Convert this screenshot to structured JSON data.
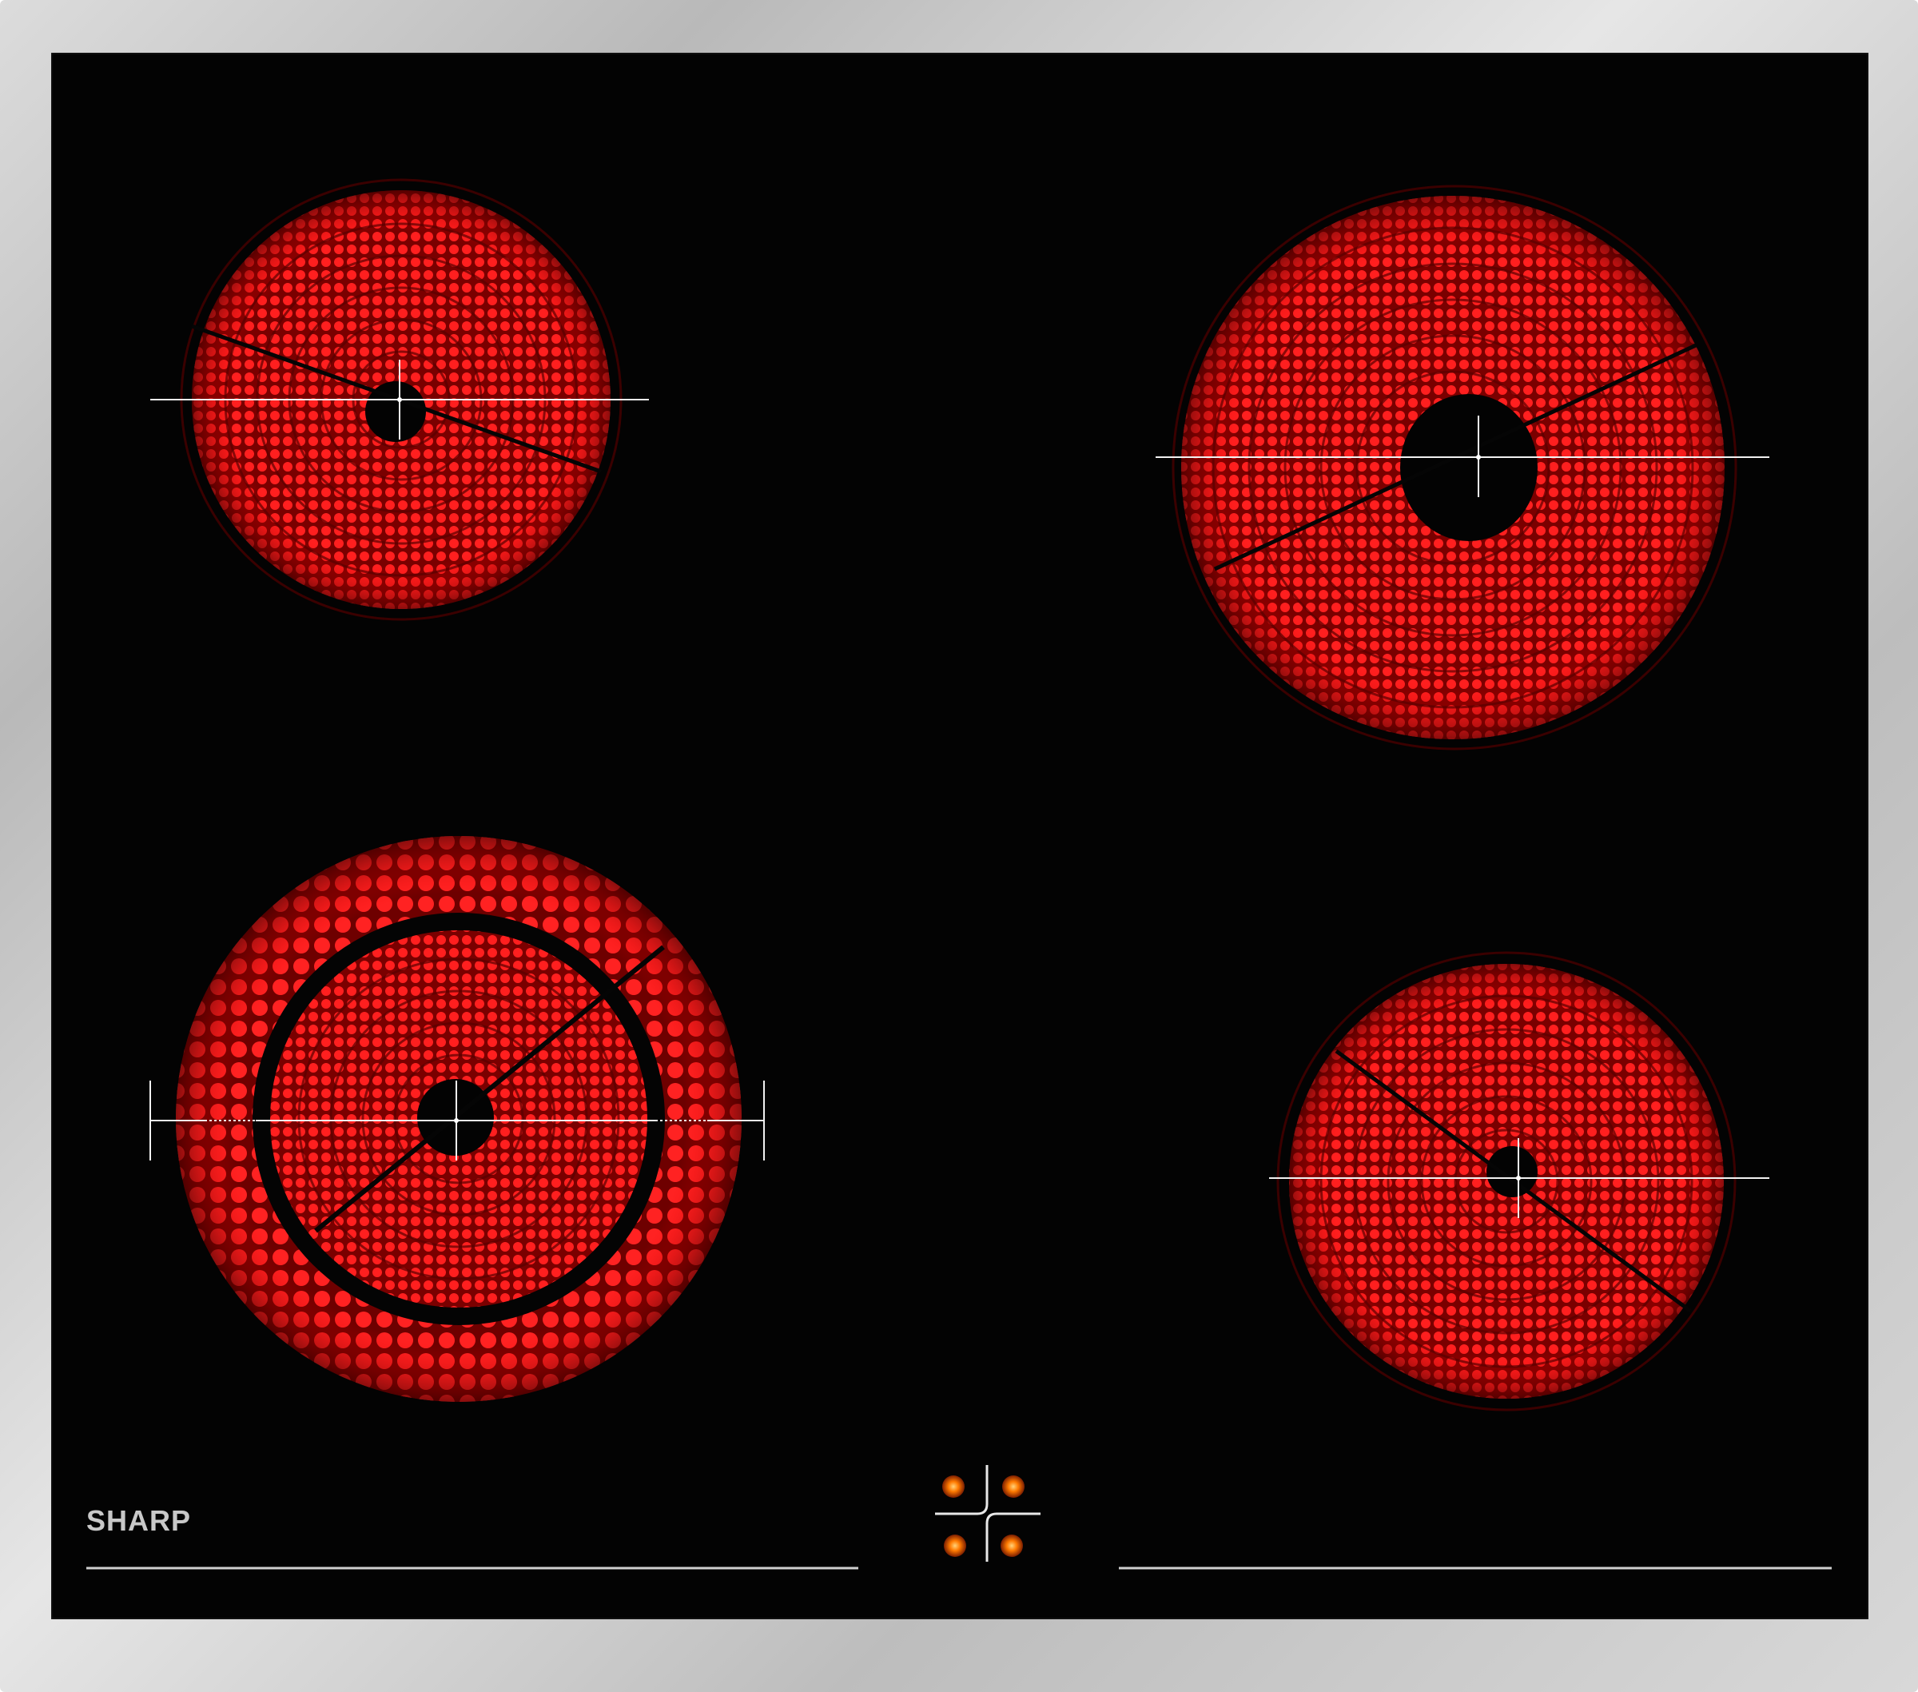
{
  "appliance": {
    "type": "ceramic-hob",
    "brand": "SHARP",
    "frame_color": "#c4c4c4",
    "glass_color": "#030303",
    "element_color": "#ff1a1a",
    "indicator_color": "#ff6a00"
  },
  "zones": [
    {
      "name": "rear-left-zone",
      "position": "rear-left",
      "state": "on",
      "rings": 1
    },
    {
      "name": "rear-right-zone",
      "position": "rear-right",
      "state": "on",
      "rings": 1
    },
    {
      "name": "front-left-zone",
      "position": "front-left",
      "state": "on",
      "rings": 2
    },
    {
      "name": "front-right-zone",
      "position": "front-right",
      "state": "on",
      "rings": 1
    }
  ],
  "indicators": [
    {
      "name": "indicator-rear-left",
      "state": "lit"
    },
    {
      "name": "indicator-rear-right",
      "state": "lit"
    },
    {
      "name": "indicator-front-left",
      "state": "lit"
    },
    {
      "name": "indicator-front-right",
      "state": "lit"
    }
  ]
}
